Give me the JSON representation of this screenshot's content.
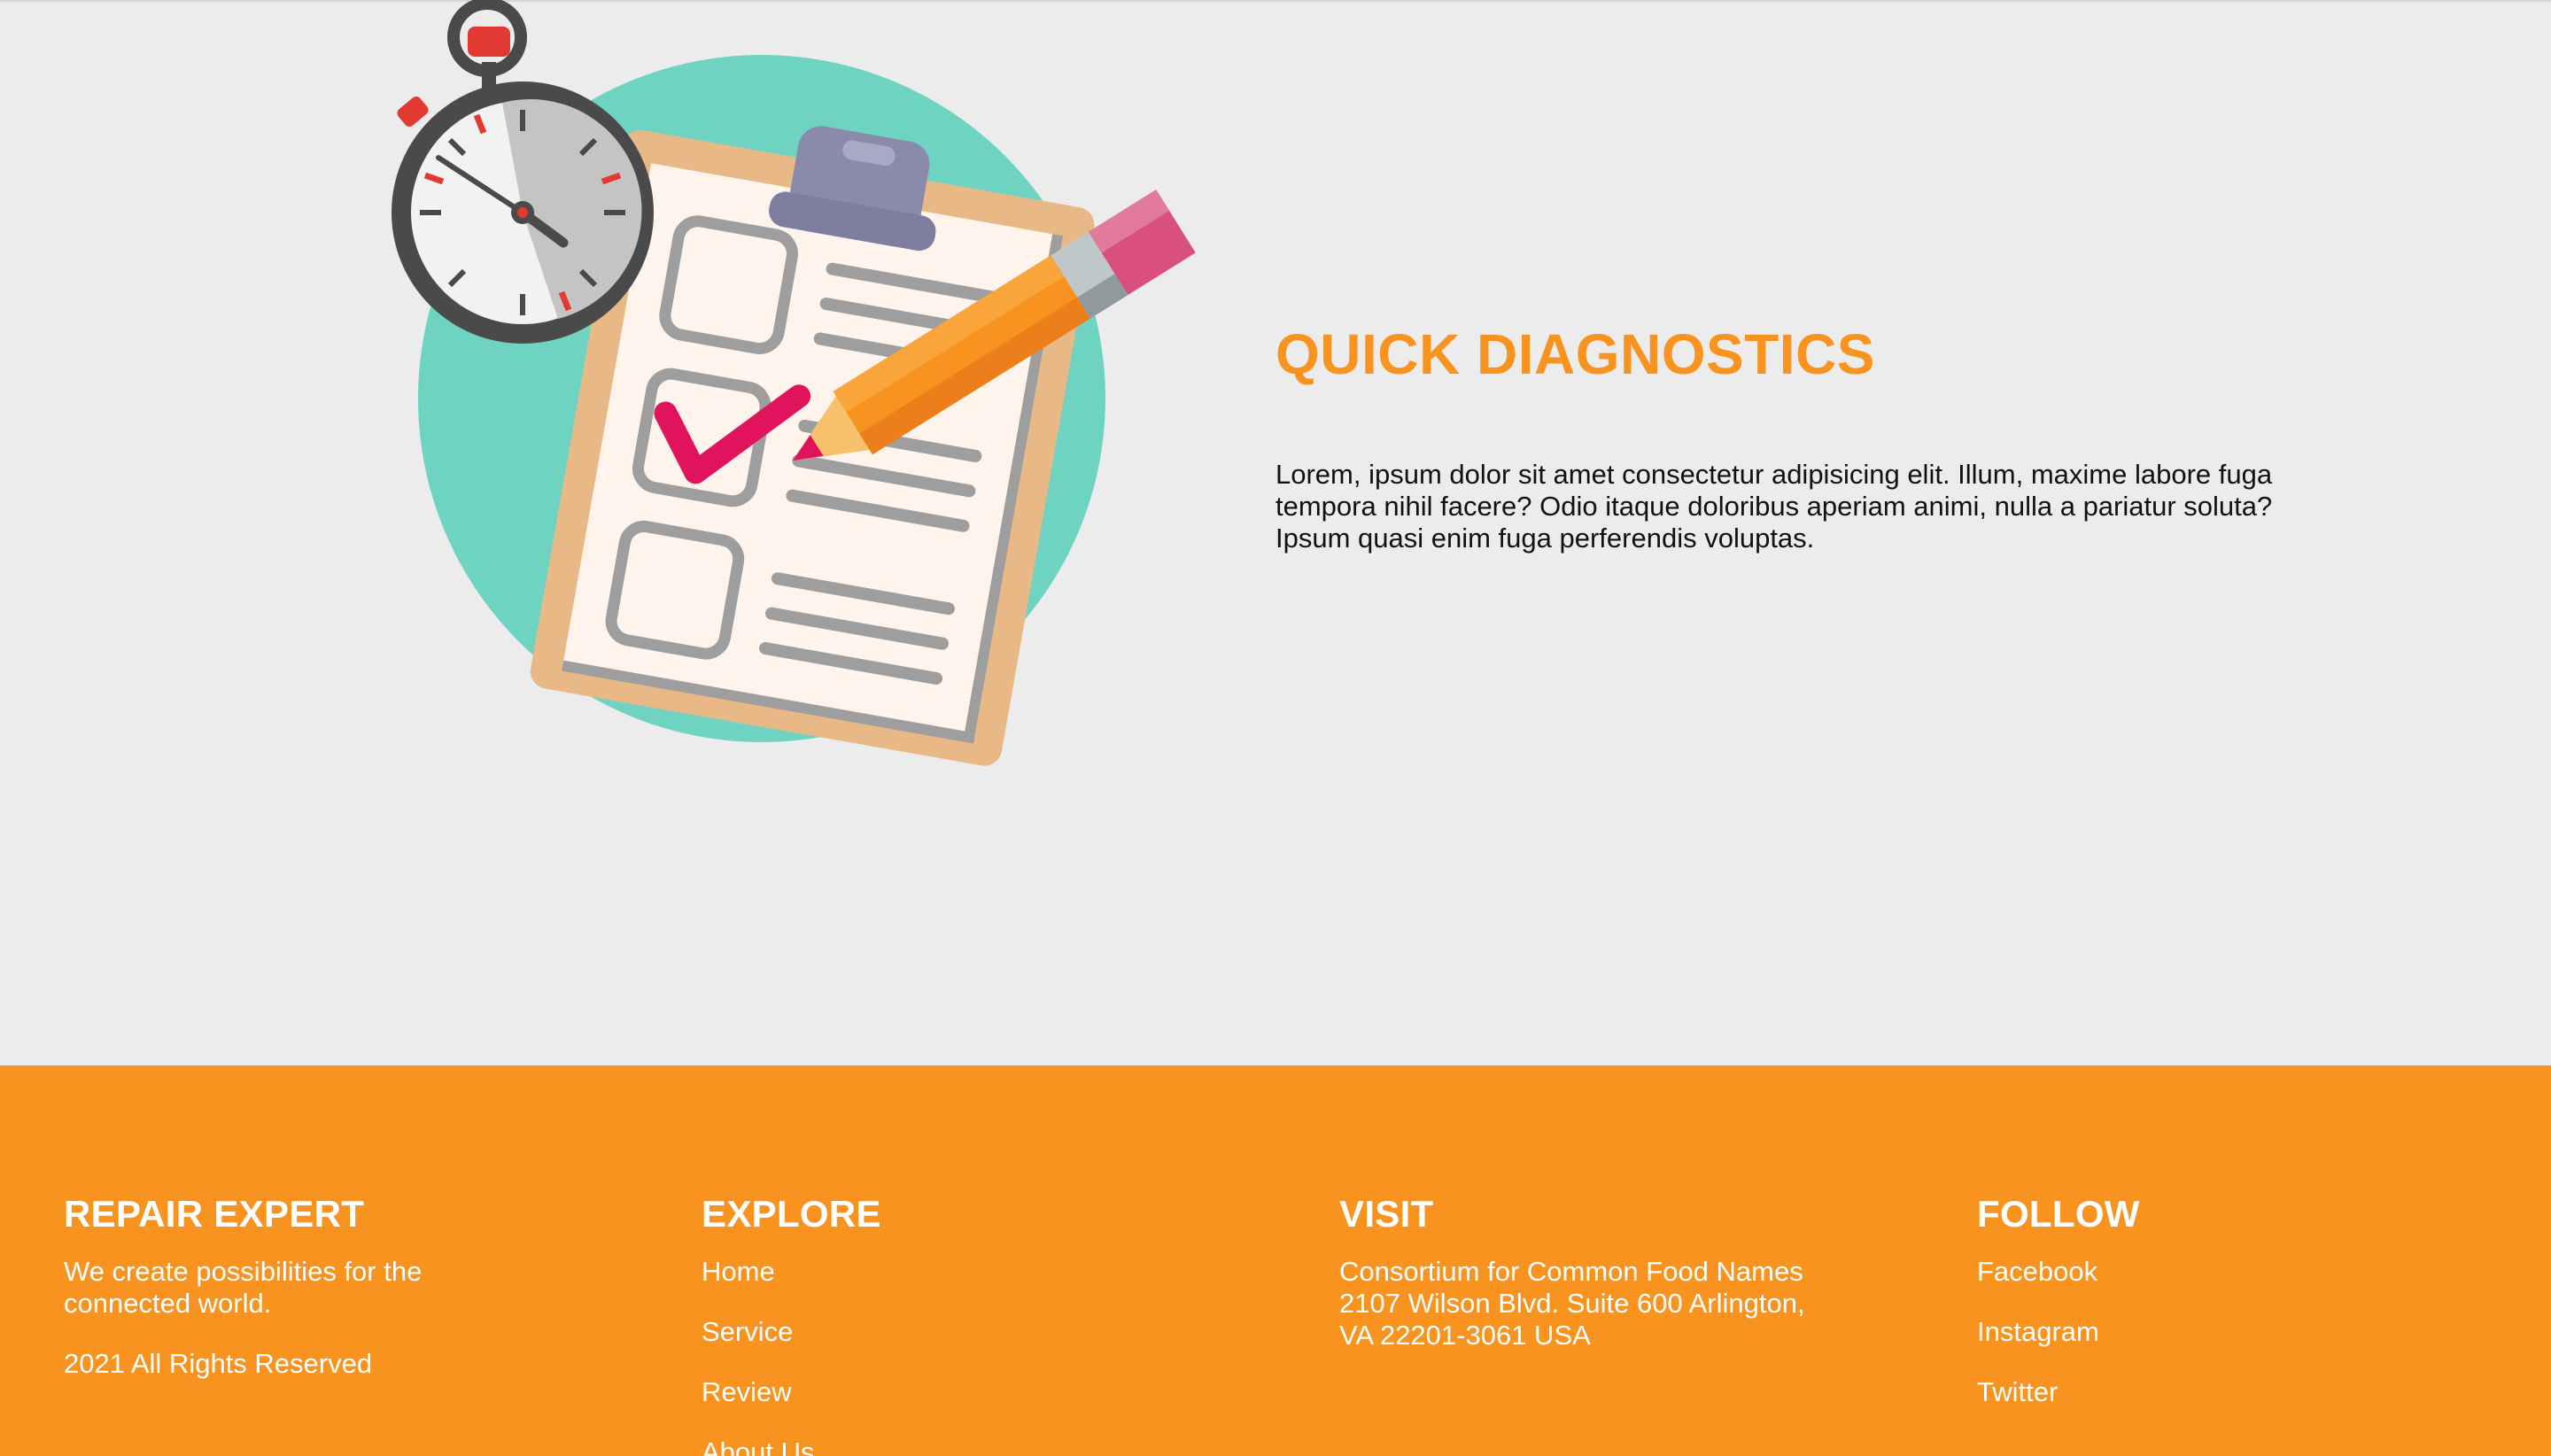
{
  "hero": {
    "title": "QUICK DIAGNOSTICS",
    "body": "Lorem, ipsum dolor sit amet consectetur adipisicing elit. Illum, maxime labore fuga tempora nihil facere? Odio itaque doloribus aperiam animi, nulla a pariatur soluta? Ipsum quasi enim fuga perferendis voluptas.",
    "illustration": {
      "icons": [
        "stopwatch-icon",
        "clipboard-icon",
        "checklist-icon",
        "checkmark-icon",
        "pencil-icon"
      ],
      "colors": {
        "circle": "#6fd3c2",
        "board": "#e8b987",
        "paper": "#fff4ec",
        "clip": "#8a8aab",
        "check": "#e0135c",
        "pencil": "#f7931e",
        "eraser": "#d94f80",
        "watch": "#444444"
      }
    }
  },
  "footer": {
    "background": "#f7931e",
    "brand": {
      "heading": "REPAIR EXPERT",
      "tagline": "We create possibilities for the connected world.",
      "copyright": "2021 All Rights Reserved"
    },
    "explore": {
      "heading": "EXPLORE",
      "links": [
        "Home",
        "Service",
        "Review",
        "About Us"
      ]
    },
    "visit": {
      "heading": "VISIT",
      "address_line1": "Consortium for Common Food Names",
      "address_line2": "2107 Wilson Blvd. Suite 600 Arlington,",
      "address_line3": "VA 22201-3061 USA"
    },
    "follow": {
      "heading": "FOLLOW",
      "links": [
        "Facebook",
        "Instagram",
        "Twitter"
      ]
    }
  },
  "colors": {
    "accent": "#f7931e",
    "page_background": "#ececec",
    "body_text": "#111111"
  }
}
